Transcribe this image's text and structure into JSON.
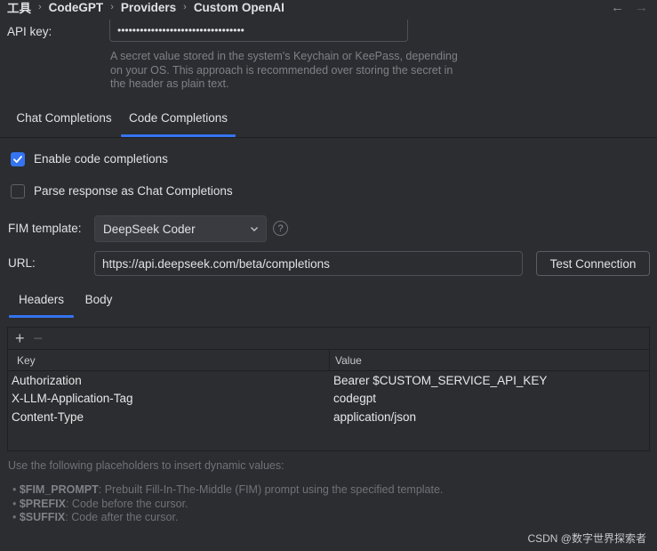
{
  "breadcrumb": [
    "工具",
    "CodeGPT",
    "Providers",
    "Custom OpenAI"
  ],
  "nav": {
    "back": "←",
    "forward": "→"
  },
  "api_key": {
    "label": "API key:",
    "value": "••••••••••••••••••••••••••••••••••",
    "hint": [
      "A secret value stored in the system's Keychain or KeePass, depending",
      "on your OS. This approach is recommended over storing the secret in",
      "the header as plain text."
    ]
  },
  "tabs": [
    {
      "label": "Chat Completions",
      "selected": false
    },
    {
      "label": "Code Completions",
      "selected": true
    }
  ],
  "options": {
    "enable_code_completions": {
      "label": "Enable code completions",
      "checked": true
    },
    "parse_response": {
      "label": "Parse response as Chat Completions",
      "checked": false
    }
  },
  "fim_template": {
    "label": "FIM template:",
    "value": "DeepSeek Coder",
    "help": "?"
  },
  "url": {
    "label": "URL:",
    "value": "https://api.deepseek.com/beta/completions",
    "test_button": "Test Connection"
  },
  "subtabs": [
    {
      "label": "Headers",
      "selected": true
    },
    {
      "label": "Body",
      "selected": false
    }
  ],
  "table": {
    "add": "+",
    "remove": "−",
    "columns": [
      "Key",
      "Value"
    ],
    "rows": [
      [
        "Authorization",
        "Bearer $CUSTOM_SERVICE_API_KEY"
      ],
      [
        "X-LLM-Application-Tag",
        "codegpt"
      ],
      [
        "Content-Type",
        "application/json"
      ]
    ]
  },
  "placeholders": {
    "intro": "Use the following placeholders to insert dynamic values:",
    "items": [
      {
        "name": "$FIM_PROMPT",
        "desc": ": Prebuilt Fill-In-The-Middle (FIM) prompt using the specified template."
      },
      {
        "name": "$PREFIX",
        "desc": ": Code before the cursor."
      },
      {
        "name": "$SUFFIX",
        "desc": ": Code after the cursor."
      }
    ]
  },
  "watermark": "CSDN @数字世界探索者",
  "colors": {
    "accent": "#3574f0",
    "background": "#2b2d30"
  }
}
